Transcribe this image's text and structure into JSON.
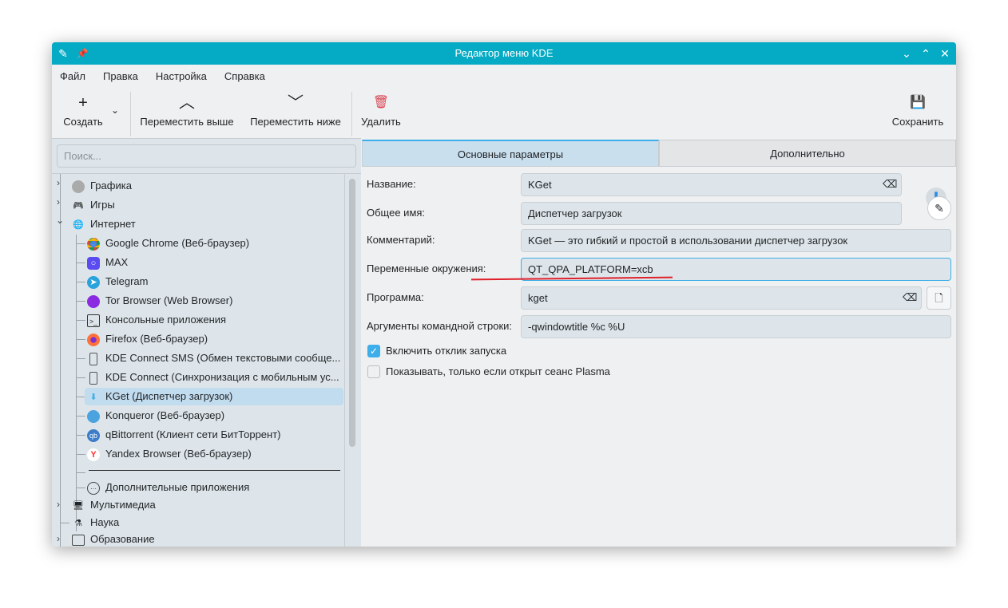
{
  "window": {
    "title": "Редактор меню KDE"
  },
  "menu": [
    "Файл",
    "Правка",
    "Настройка",
    "Справка"
  ],
  "toolbar": {
    "create": "Создать",
    "move_up": "Переместить выше",
    "move_down": "Переместить ниже",
    "delete": "Удалить",
    "save": "Сохранить"
  },
  "search": {
    "placeholder": "Поиск..."
  },
  "tree": {
    "top": [
      "Графика",
      "Игры",
      "Интернет"
    ],
    "internet": [
      "Google Chrome (Веб-браузер)",
      "MAX",
      "Telegram",
      "Tor Browser (Web Browser)",
      "Консольные приложения",
      "Firefox (Веб-браузер)",
      "KDE Connect SMS (Обмен текстовыми сообще...",
      "KDE Connect (Синхронизация с мобильным ус...",
      "KGet (Диспетчер загрузок)",
      "Konqueror (Веб-браузер)",
      "qBittorrent (Клиент сети БитТоррент)",
      "Yandex Browser (Веб-браузер)"
    ],
    "more": "Дополнительные приложения",
    "bottom": [
      "Мультимедиа",
      "Наука",
      "Образование"
    ]
  },
  "tabs": [
    "Основные параметры",
    "Дополнительно"
  ],
  "form": {
    "name_label": "Название:",
    "name": "KGet",
    "generic_label": "Общее имя:",
    "generic": "Диспетчер загрузок",
    "comment_label": "Комментарий:",
    "comment": "KGet — это гибкий и простой в использовании диспетчер загрузок",
    "env_label": "Переменные окружения:",
    "env": "QT_QPA_PLATFORM=xcb",
    "program_label": "Программа:",
    "program": "kget",
    "args_label": "Аргументы командной строки:",
    "args": "-qwindowtitle %c %U",
    "feedback_label": "Включить отклик запуска",
    "feedback": true,
    "plasma_label": "Показывать, только если открыт сеанс Plasma",
    "plasma": false
  },
  "colors": {
    "titlebar": "#05abc5",
    "selection": "#c2dcef",
    "annotation": "#e0202a"
  }
}
